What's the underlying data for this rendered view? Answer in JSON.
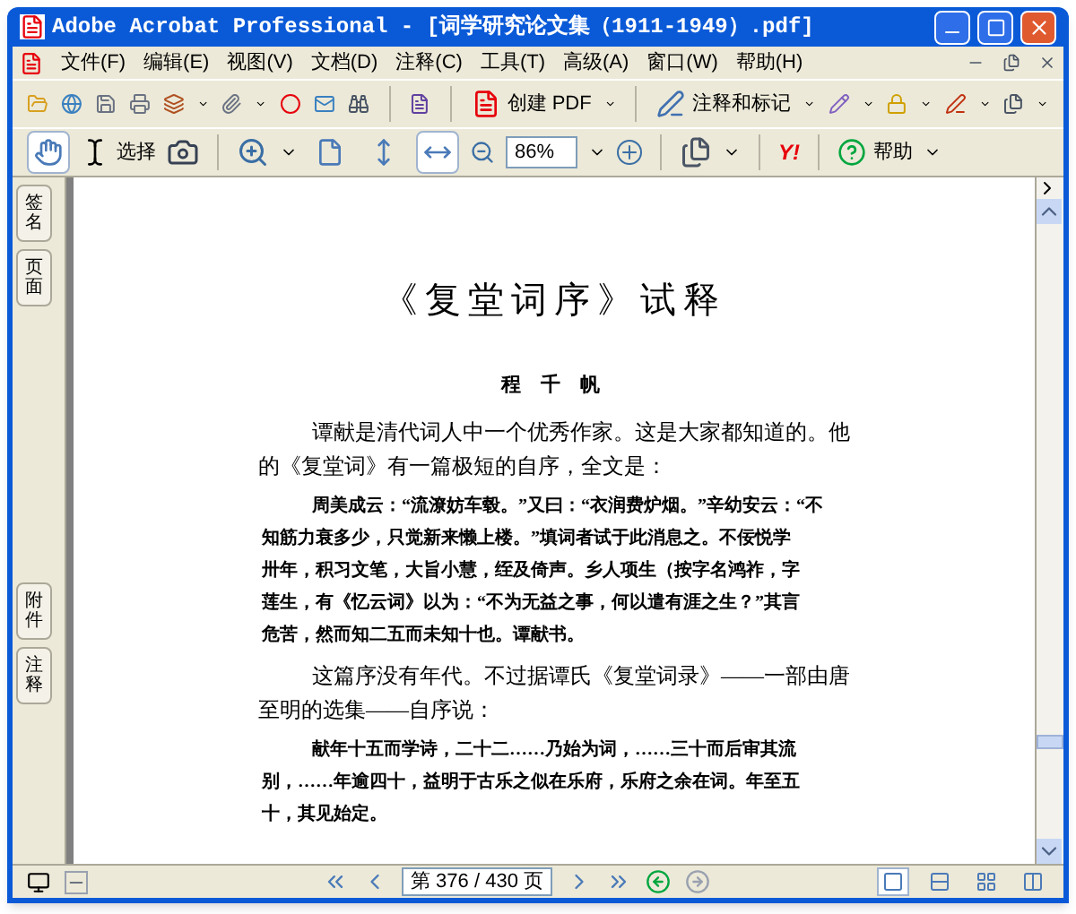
{
  "window": {
    "title": "Adobe Acrobat Professional - [词学研究论文集（1911-1949）.pdf]"
  },
  "menu": [
    "文件(F)",
    "编辑(E)",
    "视图(V)",
    "文档(D)",
    "注释(C)",
    "工具(T)",
    "高级(A)",
    "窗口(W)",
    "帮助(H)"
  ],
  "toolbar": {
    "create_pdf": "创建 PDF",
    "comment": "注释和标记",
    "select": "选择",
    "zoom": "86%",
    "help": "帮助",
    "yahoo": "Y!"
  },
  "view_buttons": [
    {
      "kind": "hand",
      "selected": true
    },
    {
      "kind": "page",
      "selected": false
    },
    {
      "kind": "fit-height",
      "selected": false
    },
    {
      "kind": "fit-width",
      "selected": true
    }
  ],
  "nav_tabs": [
    {
      "label": "签名"
    },
    {
      "label": "页面"
    },
    {
      "label": "附件"
    },
    {
      "label": "注释"
    }
  ],
  "page": {
    "title": "《复堂词序》试释",
    "author": "程 千 帆",
    "blocks": [
      {
        "kind": "para",
        "lines": [
          "谭献是清代词人中一个优秀作家。这是大家都知道的。他",
          "的《复堂词》有一篇极短的自序，全文是："
        ]
      },
      {
        "kind": "quote",
        "lines": [
          "周美成云：“流潦妨车毂。”又曰：“衣润费炉烟。”辛幼安云：“不",
          "知筋力衰多少，只觉新来懒上楼。”填词者试于此消息之。不佞悦学",
          "卅年，积习文笔，大旨小慧，绖及倚声。乡人项生（按字名鸿祚，字",
          "莲生，有《忆云词》以为：“不为无益之事，何以遣有涯之生？”其言",
          "危苦，然而知二五而未知十也。谭献书。"
        ]
      },
      {
        "kind": "para",
        "lines": [
          "这篇序没有年代。不过据谭氏《复堂词录》——一部由唐",
          "至明的选集——自序说："
        ]
      },
      {
        "kind": "quote",
        "lines": [
          "献年十五而学诗，二十二……乃始为词，……三十而后审其流",
          "别，……年逾四十，益明于古乐之似在乐府，乐府之余在词。年至五",
          "十，其见始定。"
        ]
      }
    ]
  },
  "status_bar": {
    "page_field": "第 376 / 430 页",
    "layouts": [
      {
        "selected": true
      },
      {
        "selected": false
      },
      {
        "selected": false
      },
      {
        "selected": false
      }
    ]
  }
}
